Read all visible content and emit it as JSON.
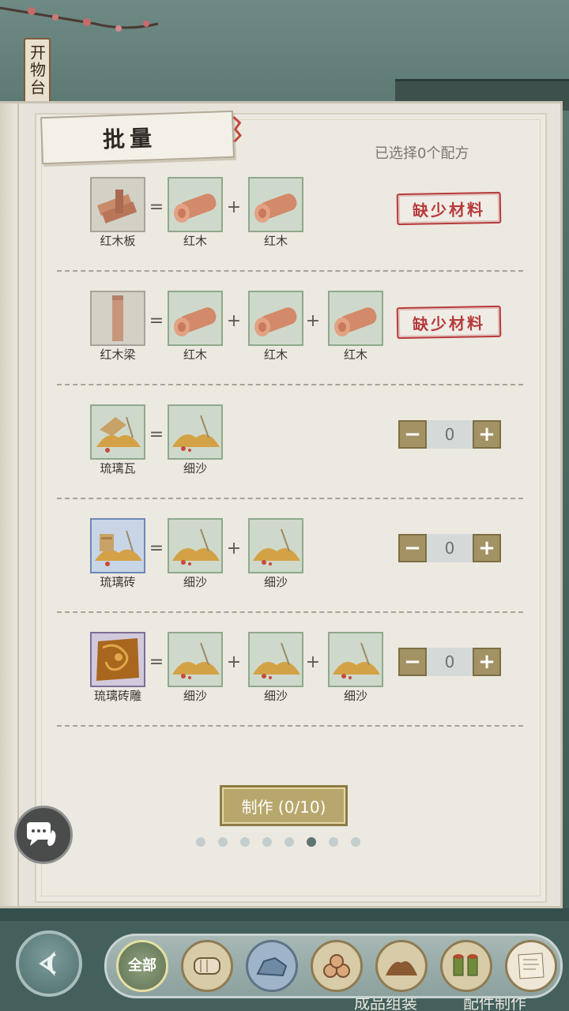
{
  "header": {
    "sign_text": "开物台",
    "title": "批量",
    "selected_count": "已选择0个配方"
  },
  "recipes": [
    {
      "product": "红木板",
      "ingredients": [
        "红木",
        "红木"
      ],
      "status": "missing",
      "status_label": "缺少材料"
    },
    {
      "product": "红木梁",
      "ingredients": [
        "红木",
        "红木",
        "红木"
      ],
      "status": "missing",
      "status_label": "缺少材料"
    },
    {
      "product": "琉璃瓦",
      "ingredients": [
        "细沙"
      ],
      "status": "available",
      "quantity": "0"
    },
    {
      "product": "琉璃砖",
      "ingredients": [
        "细沙",
        "细沙"
      ],
      "status": "available",
      "quantity": "0"
    },
    {
      "product": "琉璃砖雕",
      "ingredients": [
        "细沙",
        "细沙",
        "细沙"
      ],
      "status": "available",
      "quantity": "0"
    }
  ],
  "operators": {
    "equals": "=",
    "plus": "+"
  },
  "stepper": {
    "minus": "−",
    "plus": "+"
  },
  "make_button": "制作 (0/10)",
  "pagination": {
    "total": 8,
    "current": 6
  },
  "bottom_nav": {
    "all_label": "全部",
    "categories": [
      "all",
      "log-icon",
      "stone-icon",
      "wood-pile-icon",
      "soil-icon",
      "tea-cups-icon",
      "scroll-icon"
    ],
    "hint_left": "成品组装",
    "hint_right": "配件制作"
  },
  "colors": {
    "missing_red": "#b63a3a",
    "stepper_gold": "#a39364",
    "make_button": "#b8a76c"
  }
}
